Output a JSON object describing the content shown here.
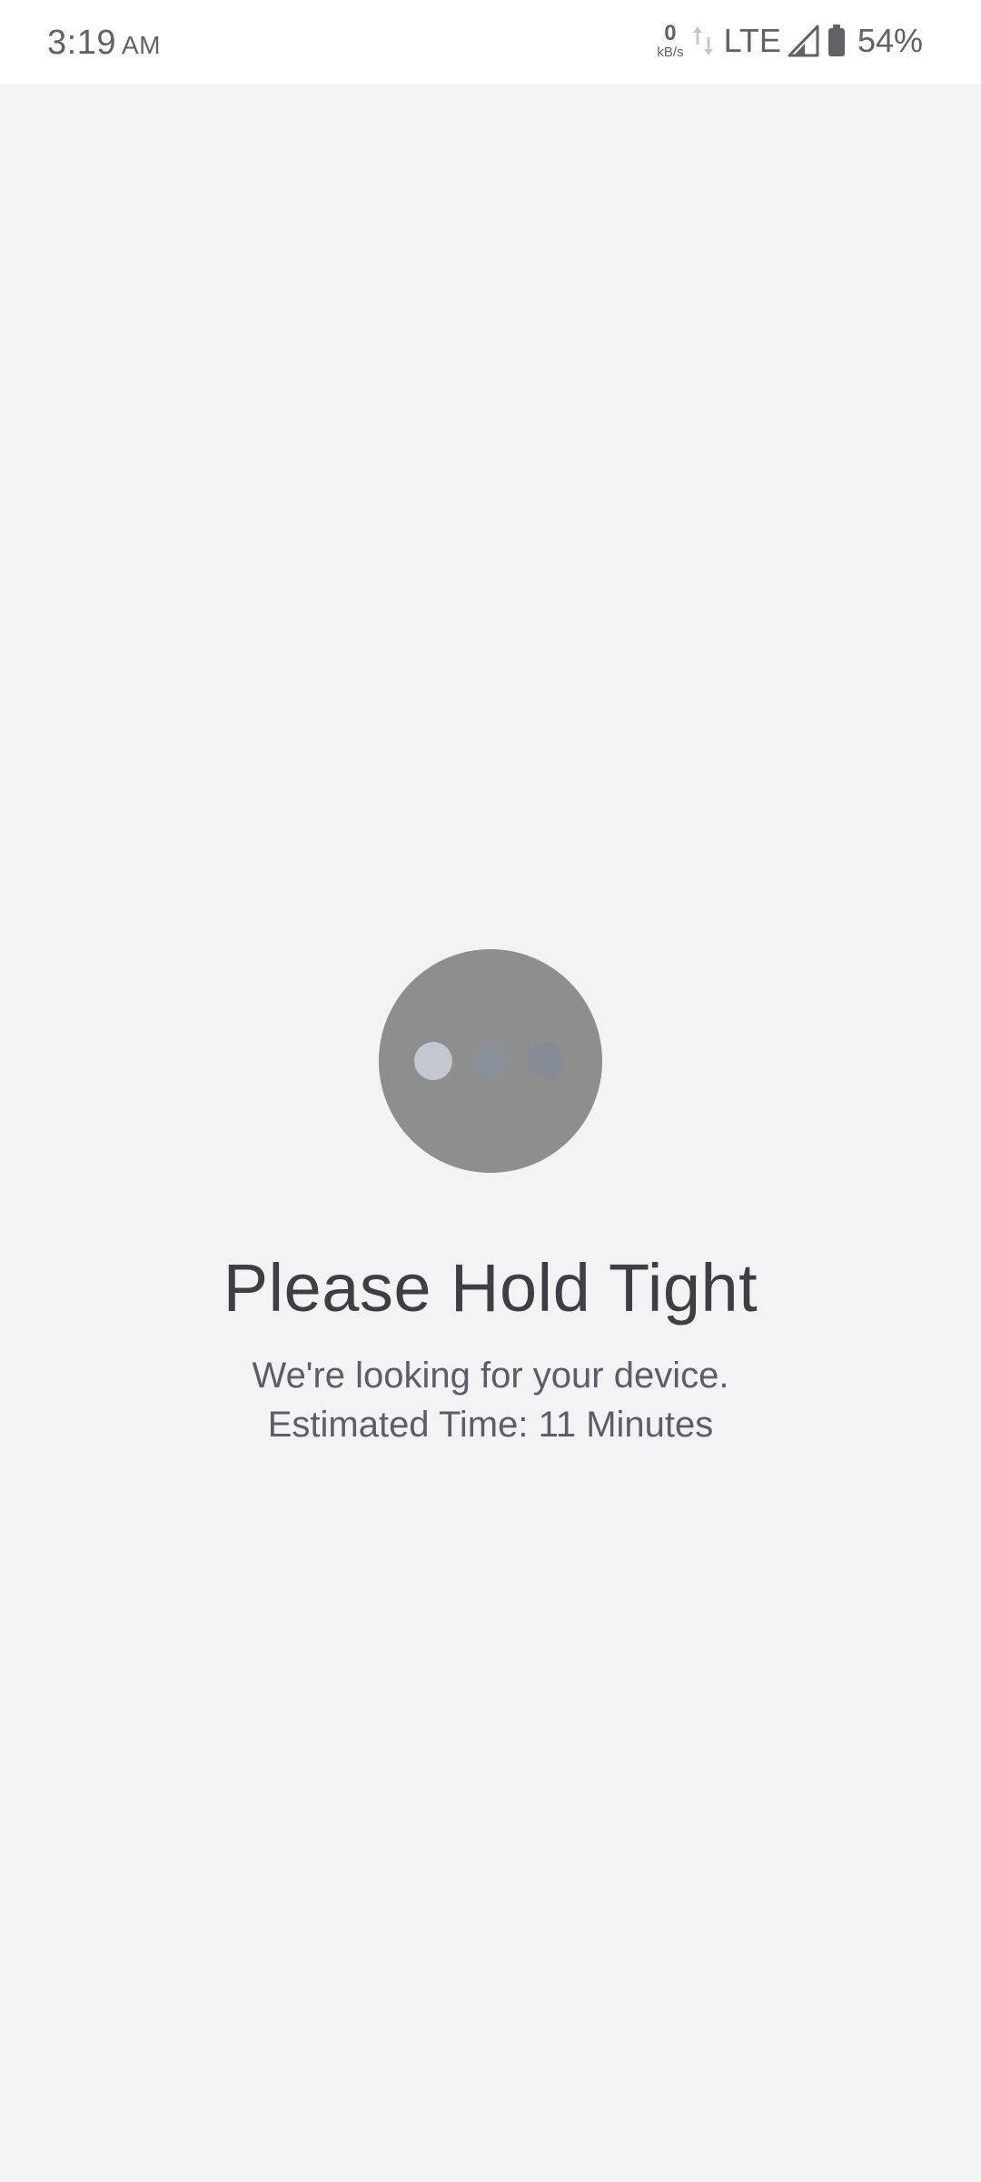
{
  "status_bar": {
    "time": "3:19",
    "ampm": "AM",
    "net_speed_value": "0",
    "net_speed_unit": "kB/s",
    "network_type": "LTE",
    "battery_percent": "54%"
  },
  "main": {
    "title": "Please Hold Tight",
    "subtitle_line1": "We're looking for your device.",
    "subtitle_line2": "Estimated Time: 11 Minutes"
  },
  "colors": {
    "background": "#f2f3f5",
    "loader_circle": "#8e8e8e",
    "dot_active": "#c3c8d0",
    "dot_inactive": "#8a9098",
    "title_text": "#3c3f44"
  },
  "icons": [
    "data-transfer-arrows-icon",
    "signal-icon",
    "battery-icon",
    "loading-dots-icon"
  ]
}
